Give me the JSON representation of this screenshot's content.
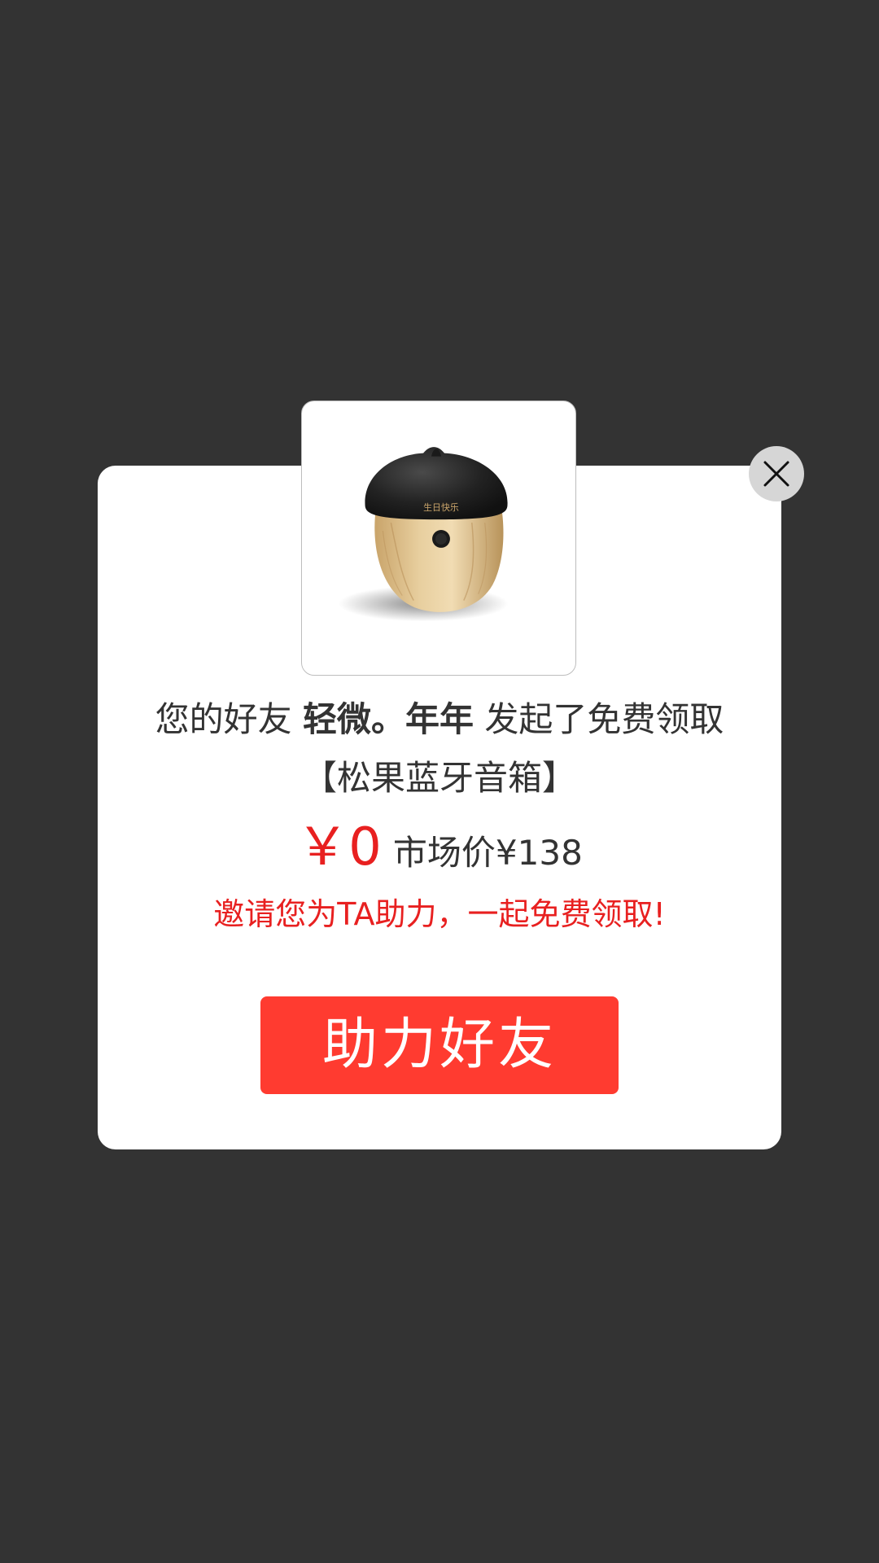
{
  "colors": {
    "backdrop": "#333333",
    "dialog_bg": "#ffffff",
    "accent_red": "#e82020",
    "button_red": "#ff3b30",
    "text_dark": "#333333",
    "close_bg": "#d6d6d6"
  },
  "close": {
    "icon": "close-icon"
  },
  "product": {
    "image_icon": "acorn-speaker-image",
    "engraving": "生日快乐"
  },
  "headline": {
    "prefix": "您的好友 ",
    "friend_name": "轻微。年年",
    "suffix": " 发起了免费领取",
    "product_name": "【松果蓝牙音箱】"
  },
  "price": {
    "current": "￥0",
    "market": "市场价¥138"
  },
  "invite": {
    "text": "邀请您为TA助力，一起免费领取!"
  },
  "cta": {
    "label": "助力好友"
  }
}
